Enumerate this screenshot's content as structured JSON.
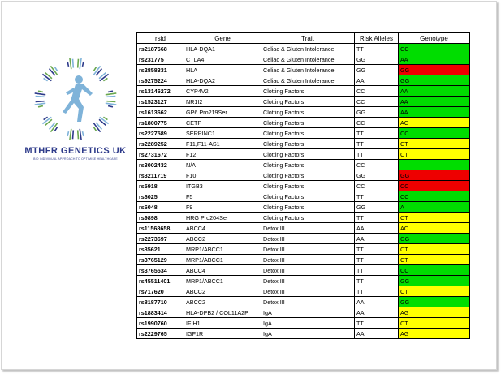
{
  "logo": {
    "line1": "MTHFR GENETICS UK",
    "line2": "BIO INDIVIDUAL APPROACH TO OPTIMISE HEALTHCARE"
  },
  "colors": {
    "green": "#00dd00",
    "yellow": "#ffff00",
    "red": "#ee0000"
  },
  "table": {
    "headers": [
      "rsid",
      "Gene",
      "Trait",
      "Risk Alleles",
      "Genotype"
    ],
    "rows": [
      {
        "rsid": "rs2187668",
        "gene": "HLA-DQA1",
        "trait": "Celiac & Gluten Intolerance",
        "risk": "TT",
        "genotype": "CC",
        "color": "green"
      },
      {
        "rsid": "rs231775",
        "gene": "CTLA4",
        "trait": "Celiac & Gluten Intolerance",
        "risk": "GG",
        "genotype": "AA",
        "color": "green"
      },
      {
        "rsid": "rs2858331",
        "gene": "HLA",
        "trait": "Celiac & Gluten Intolerance",
        "risk": "GG",
        "genotype": "GG",
        "color": "red"
      },
      {
        "rsid": "rs9275224",
        "gene": "HLA-DQA2",
        "trait": "Celiac & Gluten Intolerance",
        "risk": "AA",
        "genotype": "GG",
        "color": "green"
      },
      {
        "rsid": "rs13146272",
        "gene": "CYP4V2",
        "trait": "Clotting Factors",
        "risk": "CC",
        "genotype": "AA",
        "color": "green"
      },
      {
        "rsid": "rs1523127",
        "gene": "NR1I2",
        "trait": "Clotting Factors",
        "risk": "CC",
        "genotype": "AA",
        "color": "green"
      },
      {
        "rsid": "rs1613662",
        "gene": "GP6 Pro219Ser",
        "trait": "Clotting Factors",
        "risk": "GG",
        "genotype": "AA",
        "color": "green"
      },
      {
        "rsid": "rs1800775",
        "gene": "CETP",
        "trait": "Clotting Factors",
        "risk": "CC",
        "genotype": "AC",
        "color": "yellow"
      },
      {
        "rsid": "rs2227589",
        "gene": "SERPINC1",
        "trait": "Clotting Factors",
        "risk": "TT",
        "genotype": "CC",
        "color": "green"
      },
      {
        "rsid": "rs2289252",
        "gene": "F11,F11-AS1",
        "trait": "Clotting Factors",
        "risk": "TT",
        "genotype": "CT",
        "color": "yellow"
      },
      {
        "rsid": "rs2731672",
        "gene": "F12",
        "trait": "Clotting Factors",
        "risk": "TT",
        "genotype": "CT",
        "color": "yellow"
      },
      {
        "rsid": "rs3002432",
        "gene": "N/A",
        "trait": "Clotting Factors",
        "risk": "CC",
        "genotype": "",
        "color": "green"
      },
      {
        "rsid": "rs3211719",
        "gene": "F10",
        "trait": "Clotting Factors",
        "risk": "GG",
        "genotype": "GG",
        "color": "red"
      },
      {
        "rsid": "rs5918",
        "gene": "ITGB3",
        "trait": "Clotting Factors",
        "risk": "CC",
        "genotype": "CC",
        "color": "red"
      },
      {
        "rsid": "rs6025",
        "gene": "F5",
        "trait": "Clotting Factors",
        "risk": "TT",
        "genotype": "CC",
        "color": "green"
      },
      {
        "rsid": "rs6048",
        "gene": "F9",
        "trait": "Clotting Factors",
        "risk": "GG",
        "genotype": "A",
        "color": "green"
      },
      {
        "rsid": "rs9898",
        "gene": "HRG Pro204Ser",
        "trait": "Clotting Factors",
        "risk": "TT",
        "genotype": "CT",
        "color": "yellow"
      },
      {
        "rsid": "rs11568658",
        "gene": "ABCC4",
        "trait": "Detox III",
        "risk": "AA",
        "genotype": "AC",
        "color": "yellow"
      },
      {
        "rsid": "rs2273697",
        "gene": "ABCC2",
        "trait": "Detox III",
        "risk": "AA",
        "genotype": "GG",
        "color": "green"
      },
      {
        "rsid": "rs35621",
        "gene": "MRP1/ABCC1",
        "trait": "Detox III",
        "risk": "TT",
        "genotype": "CT",
        "color": "yellow"
      },
      {
        "rsid": "rs3765129",
        "gene": "MRP1/ABCC1",
        "trait": "Detox III",
        "risk": "TT",
        "genotype": "CT",
        "color": "yellow"
      },
      {
        "rsid": "rs3765534",
        "gene": "ABCC4",
        "trait": "Detox III",
        "risk": "TT",
        "genotype": "CC",
        "color": "green"
      },
      {
        "rsid": "rs45511401",
        "gene": "MRP1/ABCC1",
        "trait": "Detox III",
        "risk": "TT",
        "genotype": "GG",
        "color": "green"
      },
      {
        "rsid": "rs717620",
        "gene": "ABCC2",
        "trait": "Detox III",
        "risk": "TT",
        "genotype": "CT",
        "color": "yellow"
      },
      {
        "rsid": "rs8187710",
        "gene": "ABCC2",
        "trait": "Detox III",
        "risk": "AA",
        "genotype": "GG",
        "color": "green"
      },
      {
        "rsid": "rs1883414",
        "gene": "HLA-DPB2 / COL11A2P",
        "trait": "IgA",
        "risk": "AA",
        "genotype": "AG",
        "color": "yellow"
      },
      {
        "rsid": "rs1990760",
        "gene": "IFIH1",
        "trait": "IgA",
        "risk": "TT",
        "genotype": "CT",
        "color": "yellow"
      },
      {
        "rsid": "rs2229765",
        "gene": "IGF1R",
        "trait": "IgA",
        "risk": "AA",
        "genotype": "AG",
        "color": "yellow"
      }
    ]
  }
}
